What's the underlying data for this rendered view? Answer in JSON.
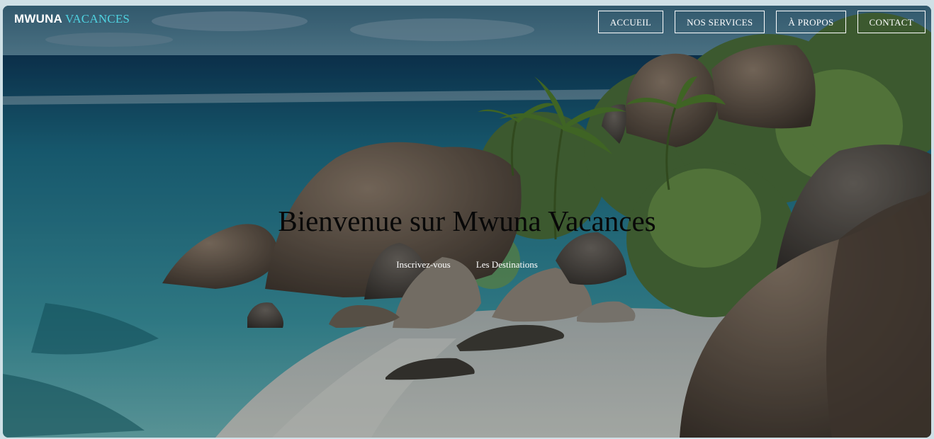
{
  "brand": {
    "part1": "MWUNA",
    "part2": "VACANCES"
  },
  "nav": {
    "items": [
      {
        "label": "ACCUEIL"
      },
      {
        "label": "NOS SERVICES"
      },
      {
        "label": "À PROPOS"
      },
      {
        "label": "CONTACT"
      }
    ]
  },
  "hero": {
    "title": "Bienvenue sur Mwuna Vacances",
    "cta_signup": "Inscrivez-vous",
    "cta_destinations": "Les Destinations"
  },
  "colors": {
    "brand_accent": "#4fd2e0",
    "nav_border": "#ffffff",
    "title_text": "#080808"
  }
}
